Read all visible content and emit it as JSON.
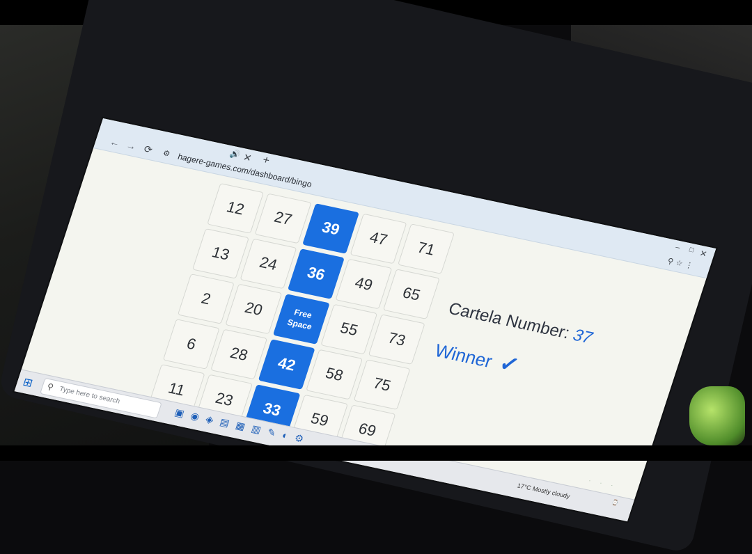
{
  "browser": {
    "url": "hagere-games.com/dashboard/bingo",
    "tab_close": "✕",
    "tab_speaker": "🔊",
    "new_tab": "+",
    "back": "←",
    "forward": "→",
    "reload": "⟳",
    "window_min": "–",
    "window_max": "□",
    "window_close": "✕"
  },
  "board": {
    "rows": [
      [
        "12",
        "27",
        "39",
        "47",
        "71"
      ],
      [
        "13",
        "24",
        "36",
        "49",
        "65"
      ],
      [
        "2",
        "20",
        "Free\nSpace",
        "55",
        "73"
      ],
      [
        "6",
        "28",
        "42",
        "58",
        "75"
      ],
      [
        "11",
        "23",
        "33",
        "59",
        "69"
      ]
    ],
    "marked": [
      "39",
      "36",
      "Free\nSpace",
      "42",
      "33"
    ],
    "marked_color": "#1a6fe0"
  },
  "result": {
    "cartela_label": "Cartela Number:",
    "cartela_number": "37",
    "status": "Winner",
    "status_icon": "✓",
    "accent_color": "#1f66d6"
  },
  "taskbar": {
    "search_placeholder": "Type here to search",
    "weather": "17°C  Mostly cloudy"
  }
}
